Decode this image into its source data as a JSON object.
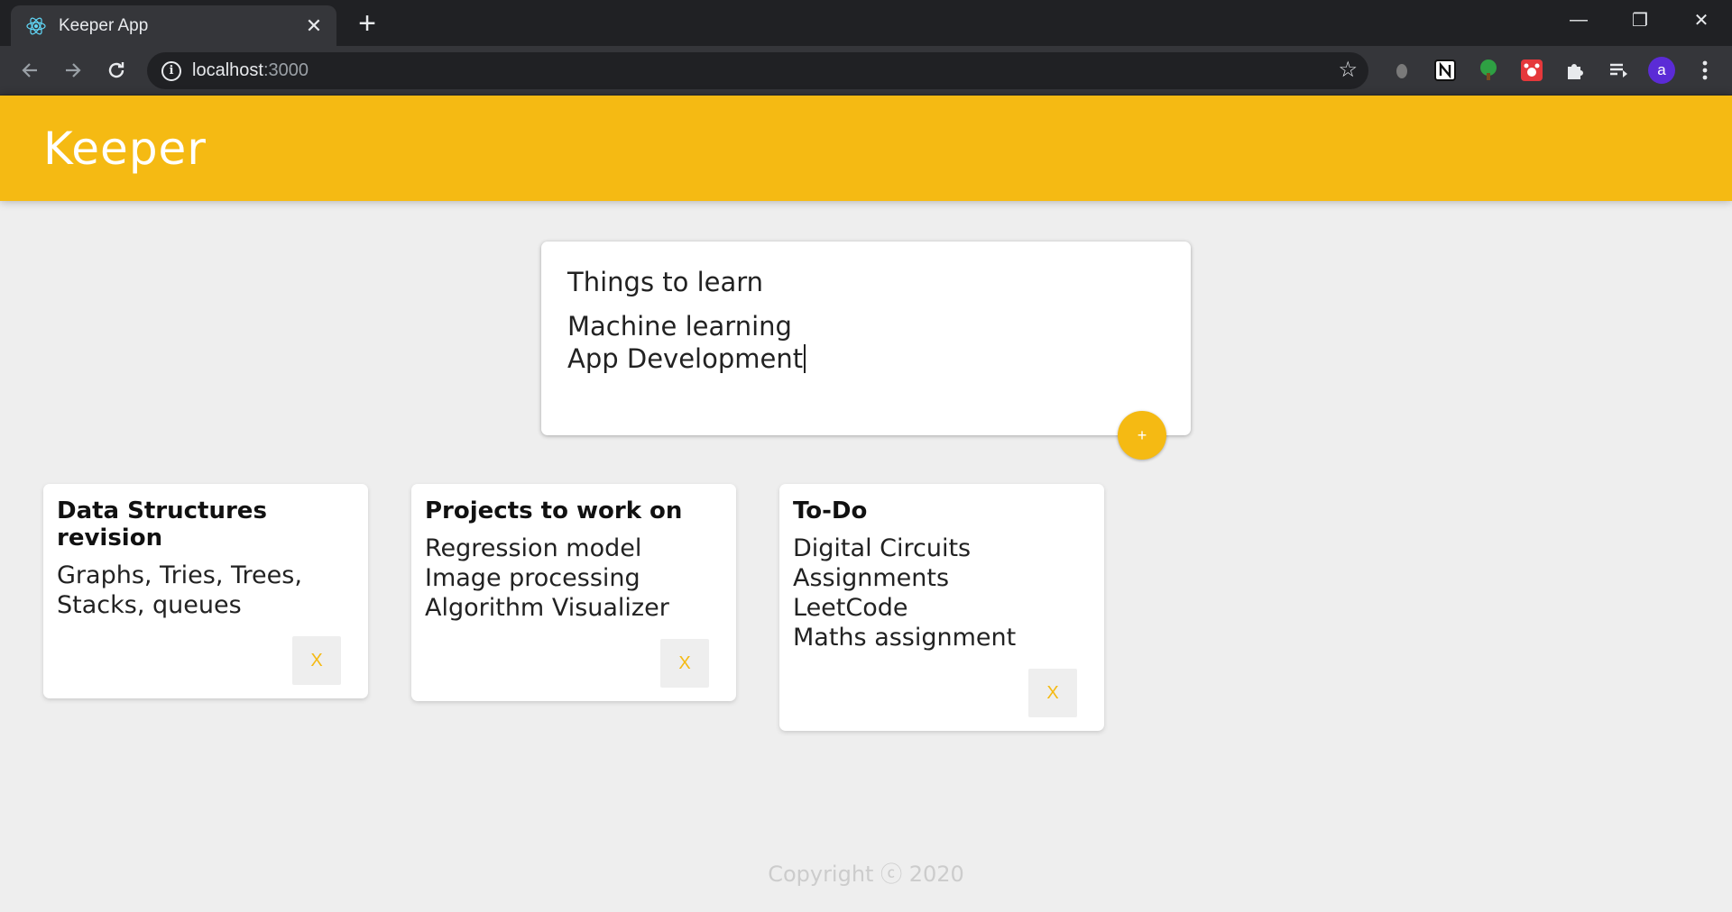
{
  "browser": {
    "tab_title": "Keeper App",
    "tab_close": "✕",
    "new_tab": "+",
    "url_host": "localhost",
    "url_port": ":3000",
    "avatar_letter": "a",
    "win": {
      "minimize": "—",
      "restore": "❐",
      "close": "✕"
    }
  },
  "app": {
    "logo": "Keeper",
    "colors": {
      "accent": "#f5ba13",
      "background": "#eeeeee"
    }
  },
  "create_note": {
    "title_value": "Things to learn",
    "content_lines": [
      "Machine learning",
      "App Development"
    ],
    "add_label": "+"
  },
  "notes": [
    {
      "title": "Data Structures revision",
      "lines": [
        "Graphs, Tries, Trees,",
        "Stacks, queues"
      ],
      "delete_label": "X"
    },
    {
      "title": "Projects to work on",
      "lines": [
        "Regression model",
        "Image processing",
        "Algorithm Visualizer"
      ],
      "delete_label": "X"
    },
    {
      "title": "To-Do",
      "lines": [
        "Digital Circuits",
        "Assignments",
        "LeetCode",
        "Maths assignment"
      ],
      "delete_label": "X"
    }
  ],
  "footer": {
    "text": "Copyright ⓒ 2020"
  }
}
